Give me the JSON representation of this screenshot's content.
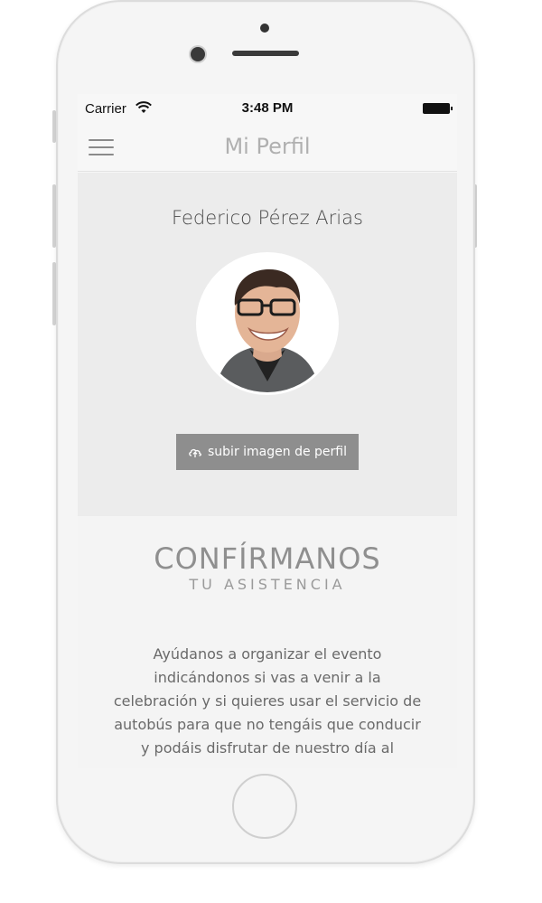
{
  "status_bar": {
    "carrier": "Carrier",
    "time": "3:48 PM",
    "wifi_icon": "wifi-icon",
    "battery_icon": "battery-icon"
  },
  "navbar": {
    "menu_icon": "hamburger-menu-icon",
    "title": "Mi Perfil"
  },
  "profile": {
    "name": "Federico Pérez Arias",
    "avatar": "avatar-photo",
    "upload_label": "subir imagen de perfil",
    "upload_icon": "upload-cloud-icon"
  },
  "confirm": {
    "title": "CONFÍRMANOS",
    "subtitle": "TU ASISTENCIA",
    "body": "Ayúdanos a organizar el evento indicándonos si vas a venir a la celebración y si quieres usar el servicio de autobús para que no tengáis que conducir y podáis disfrutar de nuestro día al"
  },
  "colors": {
    "profile_bg": "#ececec",
    "button_bg": "#8e8e8e",
    "title_gray": "#8f8f8f"
  }
}
